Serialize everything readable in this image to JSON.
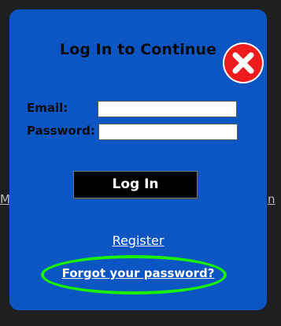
{
  "background": {
    "left_fragment": "M",
    "right_fragment": "n"
  },
  "modal": {
    "title": "Log In to Continue",
    "close_icon": "close-icon",
    "email_label": "Email:",
    "email_value": "",
    "password_label": "Password:",
    "password_value": "",
    "login_button": "Log In",
    "register_link": "Register",
    "forgot_link": "Forgot your password?",
    "colors": {
      "modal_bg": "#0c56c4",
      "close_red": "#ee1c1c",
      "highlight_ring": "#19f000",
      "button_bg": "#000000"
    }
  }
}
